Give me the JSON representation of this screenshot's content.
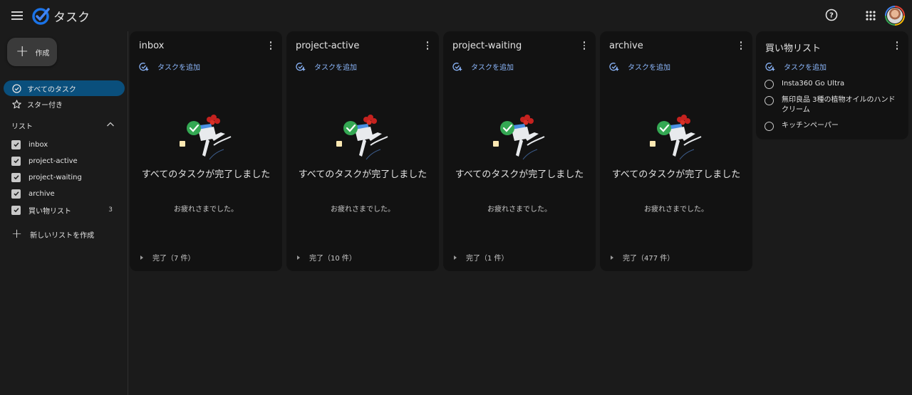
{
  "app": {
    "title": "タスク"
  },
  "icons": {
    "menu": "menu-icon",
    "logo": "tasks-logo-icon",
    "help": "help-icon",
    "apps": "apps-grid-icon"
  },
  "colors": {
    "accent": "#8ab4f8",
    "active_nav": "#0a4f7c",
    "background": "#1b1b1b",
    "card": "#121212"
  },
  "sidebar": {
    "create_label": "作成",
    "nav": [
      {
        "label": "すべてのタスク",
        "icon": "check-circle-icon",
        "active": true
      },
      {
        "label": "スター付き",
        "icon": "star-icon",
        "active": false
      }
    ],
    "lists_title": "リスト",
    "lists": [
      {
        "label": "inbox",
        "checked": true,
        "count": ""
      },
      {
        "label": "project-active",
        "checked": true,
        "count": ""
      },
      {
        "label": "project-waiting",
        "checked": true,
        "count": ""
      },
      {
        "label": "archive",
        "checked": true,
        "count": ""
      },
      {
        "label": "買い物リスト",
        "checked": true,
        "count": "3"
      }
    ],
    "new_list_label": "新しいリストを作成"
  },
  "columns": [
    {
      "title": "inbox",
      "add_task": "タスクを追加",
      "empty_title": "すべてのタスクが完了しました",
      "empty_sub": "お疲れさまでした。",
      "completed": "完了（7 件）"
    },
    {
      "title": "project-active",
      "add_task": "タスクを追加",
      "empty_title": "すべてのタスクが完了しました",
      "empty_sub": "お疲れさまでした。",
      "completed": "完了（10 件）"
    },
    {
      "title": "project-waiting",
      "add_task": "タスクを追加",
      "empty_title": "すべてのタスクが完了しました",
      "empty_sub": "お疲れさまでした。",
      "completed": "完了（1 件）"
    },
    {
      "title": "archive",
      "add_task": "タスクを追加",
      "empty_title": "すべてのタスクが完了しました",
      "empty_sub": "お疲れさまでした。",
      "completed": "完了（477 件）"
    },
    {
      "title": "買い物リスト",
      "add_task": "タスクを追加",
      "tasks": [
        "Insta360 Go Ultra",
        "無印良品 3種の植物オイルのハンドクリーム",
        "キッチンペーパー"
      ]
    }
  ]
}
